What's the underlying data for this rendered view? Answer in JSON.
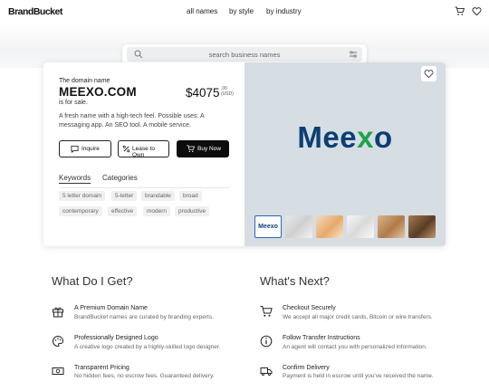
{
  "header": {
    "logo": "BrandBucket",
    "nav": [
      "all names",
      "by style",
      "by industry"
    ]
  },
  "search": {
    "placeholder": "search business names"
  },
  "domain": {
    "label": "The domain name",
    "name": "MEEXO.COM",
    "for_sale": "is for sale.",
    "price": "$4075",
    "price_cents": ".00",
    "price_currency": "(USD)",
    "description": "A fresh name with a high-tech feel. Possible uses: A messaging app. An SEO tool. A mobile service.",
    "logo_text_start": "Mee",
    "logo_text_accent": "x",
    "logo_text_end": "o",
    "thumb_logo": "Meexo"
  },
  "buttons": {
    "inquire": "Inquire",
    "lease": "Lease to Own",
    "buy": "Buy Now"
  },
  "tabs": [
    "Keywords",
    "Categories"
  ],
  "keywords": [
    "5 letter domain",
    "5-letter",
    "brandable",
    "broad",
    "contemporary",
    "effective",
    "modern",
    "productive"
  ],
  "left_section": {
    "title": "What Do I Get?",
    "items": [
      {
        "title": "A Premium Domain Name",
        "sub": "BrandBucket names are curated by branding experts."
      },
      {
        "title": "Professionally Designed Logo",
        "sub": "A creative logo created by a highly-skilled logo designer."
      },
      {
        "title": "Transparent Pricing",
        "sub": "No hidden fees, no escrow fees. Guaranteed delivery."
      }
    ]
  },
  "right_section": {
    "title": "What's Next?",
    "items": [
      {
        "title": "Checkout Securely",
        "sub": "We accept all major credit cards, Bitcoin or wire transfers."
      },
      {
        "title": "Follow Transfer Instructions",
        "sub": "An agent will contact you with personalized information."
      },
      {
        "title": "Confirm Delivery",
        "sub": "Payment is held in escrow until you've received the name."
      }
    ]
  },
  "colors": {
    "brand_blue": "#0b3f73",
    "brand_green": "#1fa34a",
    "buy_button": "#0c0c0c",
    "preview_bg": "#d6dde3"
  }
}
